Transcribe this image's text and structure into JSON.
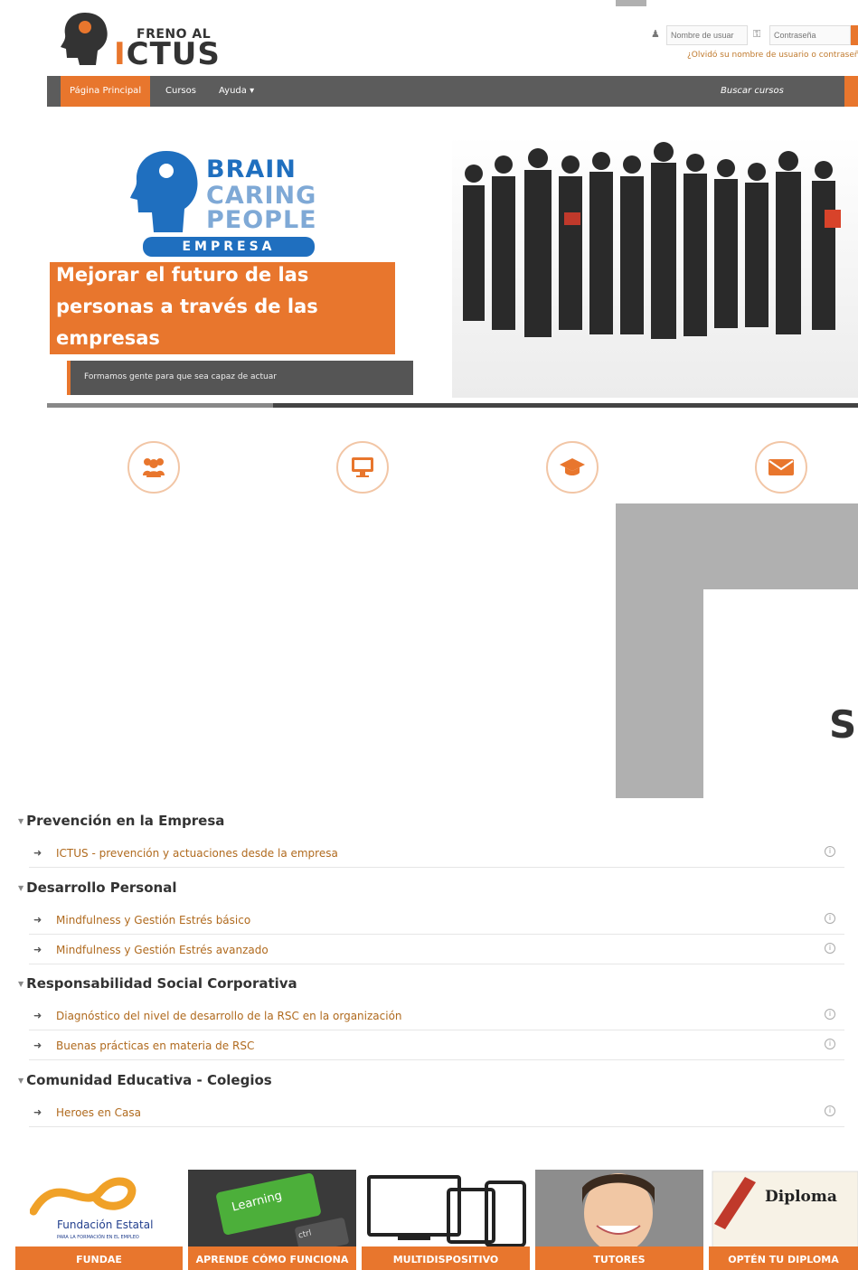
{
  "header": {
    "logo_small": "FRENO AL",
    "logo_i": "I",
    "logo_big": "CTUS",
    "username_placeholder": "Nombre de usuar",
    "password_placeholder": "Contraseña",
    "forgot": "¿Olvidó su nombre de usuario o contraseña?"
  },
  "nav": {
    "items": [
      "Página Principal",
      "Cursos",
      "Ayuda ▾"
    ],
    "search": "Buscar cursos"
  },
  "hero": {
    "bcp_line1": "BRAIN",
    "bcp_line2": "CARING",
    "bcp_line3": "PEOPLE",
    "empresa": "EMPRESA",
    "headline1": "Mejorar el futuro de las",
    "headline2": "personas a través de las",
    "headline3": "empresas",
    "strip": "Formamos gente para que sea capaz de actuar"
  },
  "big_letter": "S",
  "categories": [
    {
      "title": "Prevención en la Empresa",
      "courses": [
        "ICTUS - prevención y actuaciones desde la empresa"
      ]
    },
    {
      "title": "Desarrollo Personal",
      "courses": [
        "Mindfulness y Gestión Estrés básico",
        "Mindfulness y Gestión Estrés avanzado"
      ]
    },
    {
      "title": "Responsabilidad Social Corporativa",
      "courses": [
        "Diagnóstico del nivel de desarrollo de la RSC en la organización",
        "Buenas prácticas en materia de RSC"
      ]
    },
    {
      "title": "Comunidad Educativa - Colegios",
      "courses": [
        "Heroes en Casa"
      ]
    }
  ],
  "carousel": {
    "prev": "<",
    "next": ">",
    "fundae_line1": "Fundación Estatal",
    "fundae_line2": "PARA LA FORMACIÓN EN EL EMPLEO",
    "learning_key": "Learning",
    "ctrl_key": "ctrl",
    "diploma": "Diploma",
    "tiles": [
      "FUNDAE",
      "APRENDE CÓMO FUNCIONA",
      "MULTIDISPOSITIVO",
      "TUTORES",
      "OPTÉN TU DIPLOMA"
    ]
  },
  "colors": {
    "accent": "#e8762d",
    "nav": "#5c5c5c",
    "brand_blue": "#1f6fbf"
  }
}
